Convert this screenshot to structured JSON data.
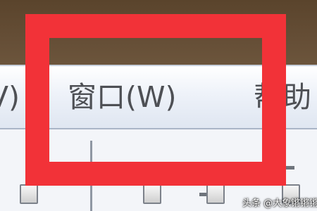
{
  "menubar": {
    "items": [
      {
        "label": "V)"
      },
      {
        "label": "窗口(W)"
      },
      {
        "label": "帮助"
      }
    ]
  },
  "highlight": {
    "color": "#f23238"
  },
  "watermark": {
    "text": "头条 @大象锵锵锵"
  }
}
